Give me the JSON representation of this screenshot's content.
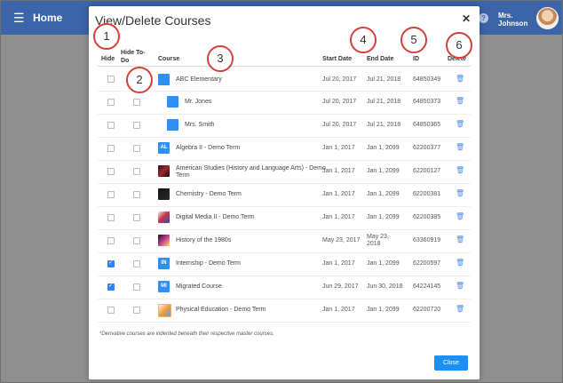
{
  "topbar": {
    "home_label": "Home",
    "user_line1": "Mrs.",
    "user_line2": "Johnson",
    "help_symbol": "?"
  },
  "modal": {
    "title": "View/Delete Courses",
    "close_symbol": "✕",
    "headers": {
      "hide": "Hide",
      "hide_todo": "Hide To-Do",
      "course": "Course",
      "start_date": "Start Date",
      "end_date": "End Date",
      "id": "ID",
      "delete": "Delete"
    },
    "rows": [
      {
        "hide": false,
        "todo": null,
        "thumb": "",
        "course": "ABC Elementary",
        "start": "Jul 20, 2017",
        "end": "Jul 21, 2018",
        "id": "64850349",
        "delete": "🗑"
      },
      {
        "hide": false,
        "todo": false,
        "thumb": "",
        "course": "Mr. Jones",
        "start": "Jul 20, 2017",
        "end": "Jul 21, 2018",
        "id": "64850373",
        "delete": "🗑"
      },
      {
        "hide": false,
        "todo": false,
        "thumb": "",
        "course": "Mrs. Smith",
        "start": "Jul 20, 2017",
        "end": "Jul 21, 2018",
        "id": "64850365",
        "delete": "🗑"
      },
      {
        "hide": false,
        "todo": false,
        "thumb": "AL",
        "course": "Algebra II - Demo Term",
        "start": "Jan 1, 2017",
        "end": "Jan 1, 2099",
        "id": "62200377",
        "delete": "🗑"
      },
      {
        "hide": false,
        "todo": false,
        "thumb": "",
        "course": "American Studies (History and Language Arts) - Demo Term",
        "start": "Jan 1, 2017",
        "end": "Jan 1, 2099",
        "id": "62200127",
        "delete": "🗑"
      },
      {
        "hide": false,
        "todo": false,
        "thumb": "",
        "course": "Chemistry - Demo Term",
        "start": "Jan 1, 2017",
        "end": "Jan 1, 2099",
        "id": "62200381",
        "delete": "🗑"
      },
      {
        "hide": false,
        "todo": false,
        "thumb": "",
        "course": "Digital Media II - Demo Term",
        "start": "Jan 1, 2017",
        "end": "Jan 1, 2099",
        "id": "62200385",
        "delete": "🗑"
      },
      {
        "hide": false,
        "todo": false,
        "thumb": "",
        "course": "History of the 1980s",
        "start": "May 23, 2017",
        "end": "May 23, 2018",
        "id": "63360919",
        "delete": "🗑"
      },
      {
        "hide": true,
        "todo": false,
        "thumb": "IN",
        "course": "Internship - Demo Term",
        "start": "Jan 1, 2017",
        "end": "Jan 1, 2099",
        "id": "62200597",
        "delete": "🗑"
      },
      {
        "hide": true,
        "todo": false,
        "thumb": "MI",
        "course": "Migrated Course",
        "start": "Jun 29, 2017",
        "end": "Jun 30, 2018",
        "id": "64224145",
        "delete": "🗑"
      },
      {
        "hide": false,
        "todo": false,
        "thumb": "",
        "course": "Physical Education - Demo Term",
        "start": "Jan 1, 2017",
        "end": "Jan 1, 2099",
        "id": "62200720",
        "delete": "🗑"
      }
    ],
    "footnote": "*Derivative courses are indented beneath their respective master courses.",
    "close_label": "Close"
  },
  "markers": [
    "1",
    "2",
    "3",
    "4",
    "5",
    "6"
  ],
  "colors": {
    "topbar": "#3c64a8",
    "button": "#1d8ff0",
    "marker_border": "#d43f3a"
  }
}
